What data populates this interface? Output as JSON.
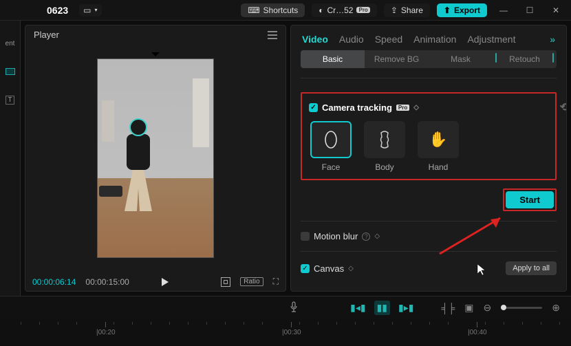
{
  "topbar": {
    "project_title": "0623",
    "shortcuts_label": "Shortcuts",
    "credits_label": "Cr…52",
    "credits_badge": "Pro",
    "share_label": "Share",
    "export_label": "Export"
  },
  "left_panel": {
    "snippet": "ent"
  },
  "player": {
    "title": "Player",
    "current_tc": "00:00:06:14",
    "total_tc": "00:00:15:00",
    "ratio_label": "Ratio"
  },
  "tabs": {
    "items": [
      "Video",
      "Audio",
      "Speed",
      "Animation",
      "Adjustment"
    ],
    "active_index": 0
  },
  "subtabs": {
    "items": [
      "Basic",
      "Remove BG",
      "Mask",
      "Retouch"
    ],
    "active_index": 0
  },
  "camera_tracking": {
    "title": "Camera tracking",
    "badge": "Pro",
    "checked": true,
    "modes": [
      {
        "label": "Face"
      },
      {
        "label": "Body"
      },
      {
        "label": "Hand"
      }
    ],
    "active_mode": 0,
    "start_label": "Start"
  },
  "motion_blur": {
    "title": "Motion blur",
    "checked": false
  },
  "canvas_section": {
    "title": "Canvas",
    "checked": true,
    "apply_all_label": "Apply to all"
  },
  "timeline": {
    "ticks": [
      "|00:20",
      "|00:30",
      "|00:40"
    ]
  }
}
